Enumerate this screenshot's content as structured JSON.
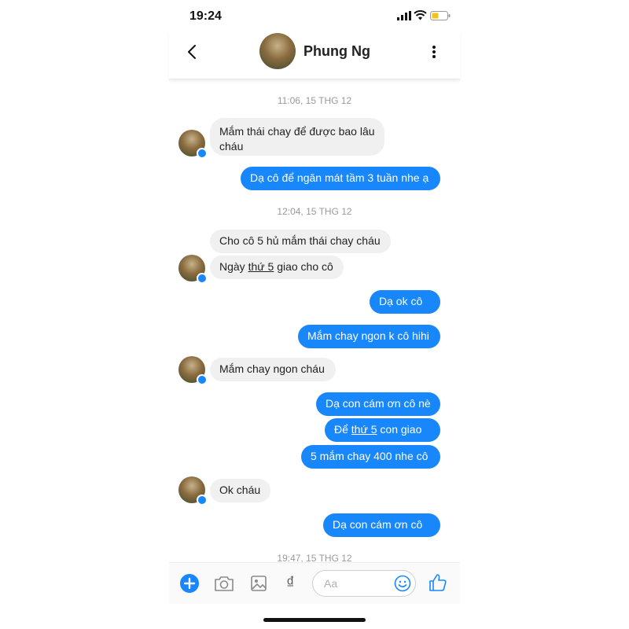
{
  "status_bar": {
    "time": "19:24"
  },
  "header": {
    "contact_name": "Phung Ng"
  },
  "timestamps": [
    "11:06, 15 THG 12",
    "12:04, 15 THG 12",
    "19:47, 15 THG 12"
  ],
  "messages": [
    {
      "side": "in",
      "text_line1": "Mắm thái chay để được bao lâu",
      "text_line2": "cháu"
    },
    {
      "side": "out",
      "text": "Dạ cô để ngăn mát tầm 3 tuần nhe ạ"
    },
    {
      "side": "in",
      "text": "Cho cô 5 hủ mắm thái chay cháu"
    },
    {
      "side": "in",
      "pre": "Ngày ",
      "link": "thứ 5",
      "post": " giao cho cô"
    },
    {
      "side": "out",
      "text": "Dạ ok cô ạ"
    },
    {
      "side": "out",
      "text": "Mắm chay ngon k cô hihi"
    },
    {
      "side": "in",
      "text": "Mắm chay ngon cháu"
    },
    {
      "side": "out",
      "text": "Dạ con cám ơn cô nè"
    },
    {
      "side": "out",
      "pre": "Để ",
      "link": "thứ 5",
      "post": " con giao ạ"
    },
    {
      "side": "out",
      "text": "5 mắm chay 400 nhe cô"
    },
    {
      "side": "in",
      "text": "Ok cháu"
    },
    {
      "side": "out",
      "text": "Dạ con cám ơn cô ạ"
    }
  ],
  "composer": {
    "placeholder": "Aa",
    "currency_symbol": "₫"
  },
  "colors": {
    "accent": "#1787fb",
    "incoming_bubble": "#f0f0f0",
    "timestamp": "#9a9a9a"
  },
  "icons": [
    "back-chevron-icon",
    "more-vertical-icon",
    "plus-icon",
    "camera-icon",
    "gallery-icon",
    "emoji-icon",
    "thumbs-up-icon",
    "messenger-badge-icon"
  ]
}
